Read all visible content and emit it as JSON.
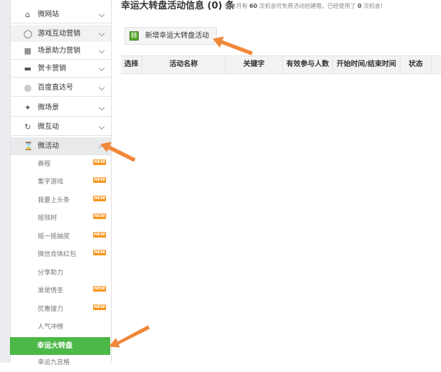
{
  "sidebar": {
    "menus": [
      {
        "label": "微网站",
        "icon": "home-icon"
      },
      {
        "label": "游戏互动营销",
        "icon": "gamepad-icon"
      },
      {
        "label": "场景助力营销",
        "icon": "building-icon"
      },
      {
        "label": "贺卡营销",
        "icon": "card-icon"
      },
      {
        "label": "百度直达号",
        "icon": "target-icon"
      },
      {
        "label": "微场景",
        "icon": "sparkle-icon"
      },
      {
        "label": "微互动",
        "icon": "interact-icon"
      },
      {
        "label": "微活动",
        "icon": "hourglass-icon"
      }
    ],
    "subitems": [
      {
        "label": "赛程",
        "badge": "NEW"
      },
      {
        "label": "集字游戏",
        "badge": "NEW"
      },
      {
        "label": "我要上头条",
        "badge": "NEW"
      },
      {
        "label": "摇钱树",
        "badge": "NEW"
      },
      {
        "label": "摇一摇抽奖",
        "badge": "NEW"
      },
      {
        "label": "微信合体红包",
        "badge": "NEW"
      },
      {
        "label": "分享助力",
        "badge": ""
      },
      {
        "label": "准是情圣",
        "badge": "NEW"
      },
      {
        "label": "优惠接力",
        "badge": "NEW"
      },
      {
        "label": "人气冲榜",
        "badge": ""
      },
      {
        "label": "幸运大转盘",
        "badge": ""
      },
      {
        "label": "幸运九宫格",
        "badge": ""
      }
    ]
  },
  "header": {
    "title": "幸运大转盘活动信息 (0) 条",
    "note_prefix": "你本月有",
    "note_count": "60",
    "note_middle": "次机会可免费活动创建哦，已经使用了",
    "note_used": "0",
    "note_suffix": "次机会!"
  },
  "add_button": {
    "label": "新增幸运大转盘活动",
    "icon_text": "转"
  },
  "table": {
    "columns": [
      "选择",
      "活动名称",
      "关键字",
      "有效参与人数",
      "开始时间/结束时间",
      "状态"
    ]
  },
  "colors": {
    "active_green": "#4cb848",
    "badge_orange": "#f7941d",
    "arrow_orange": "#f0883a"
  }
}
